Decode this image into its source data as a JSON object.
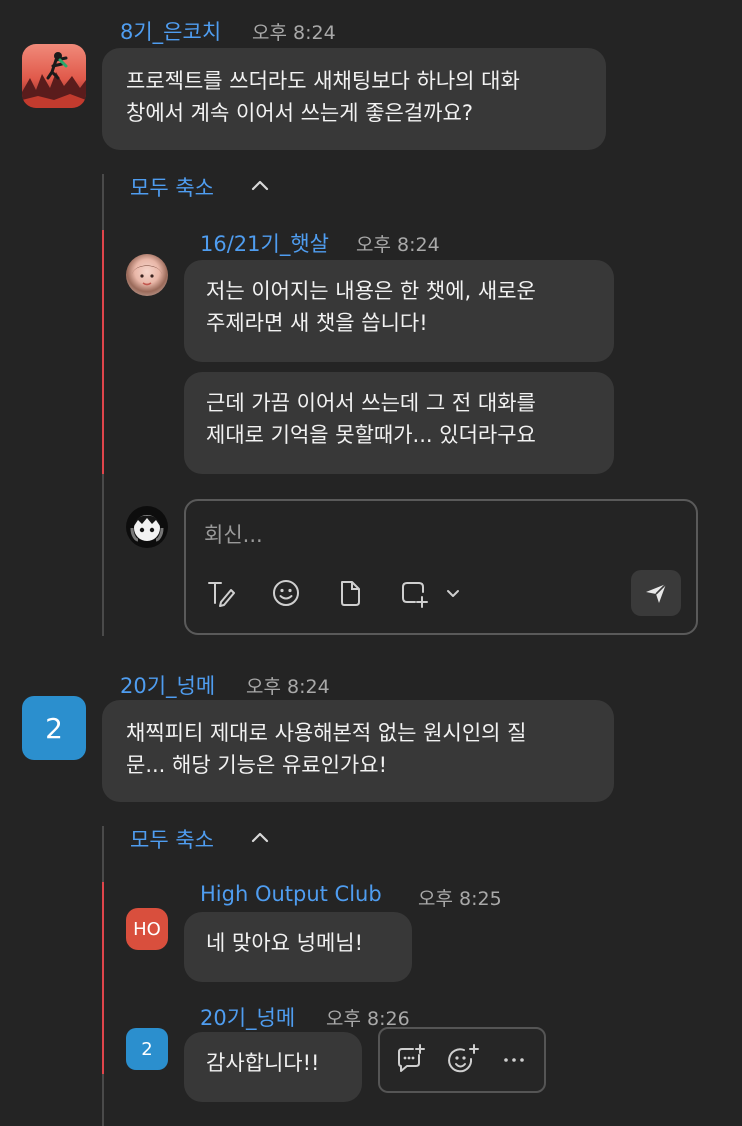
{
  "messages": [
    {
      "author": "8기_은코치",
      "time": "오후 8:24",
      "lines": [
        "프로젝트를 쓰더라도 새채팅보다 하나의 대화",
        "창에서 계속 이어서 쓰는게 좋은걸까요?"
      ],
      "thread": {
        "collapse_label": "모두 축소",
        "replies": [
          {
            "author": "16/21기_햇살",
            "time": "오후 8:24",
            "bubbles": [
              [
                "저는 이어지는 내용은 한 챗에, 새로운",
                "주제라면 새 챗을 씁니다!"
              ],
              [
                "근데 가끔 이어서 쓰는데 그 전 대화를",
                "제대로 기억을 못할때가... 있더라구요"
              ]
            ]
          }
        ],
        "reply_placeholder": "회신..."
      }
    },
    {
      "author": "20기_넝메",
      "avatar_text": "2",
      "time": "오후 8:24",
      "lines": [
        "채찍피티 제대로 사용해본적 없는 원시인의 질",
        "문... 해당 기능은 유료인가요!"
      ],
      "thread": {
        "collapse_label": "모두 축소",
        "replies": [
          {
            "author": "High Output Club",
            "avatar_text": "HO",
            "time": "오후 8:25",
            "text": "네 맞아요 넝메님!"
          },
          {
            "author": "20기_넝메",
            "avatar_text": "2",
            "time": "오후 8:26",
            "text": "감사합니다!!"
          }
        ]
      }
    }
  ],
  "colors": {
    "background": "#242424",
    "bubble": "#383838",
    "name": "#4f9df0",
    "thread_accent": "#e0454b",
    "ho_avatar": "#d94f3d",
    "num_avatar": "#2b8fce"
  },
  "icons": {
    "format": "text-format-icon",
    "emoji": "emoji-icon",
    "file": "file-icon",
    "screenshot": "screenshot-icon",
    "send": "send-icon",
    "reply": "reply-in-thread-icon",
    "react": "add-reaction-icon",
    "more": "more-icon"
  }
}
